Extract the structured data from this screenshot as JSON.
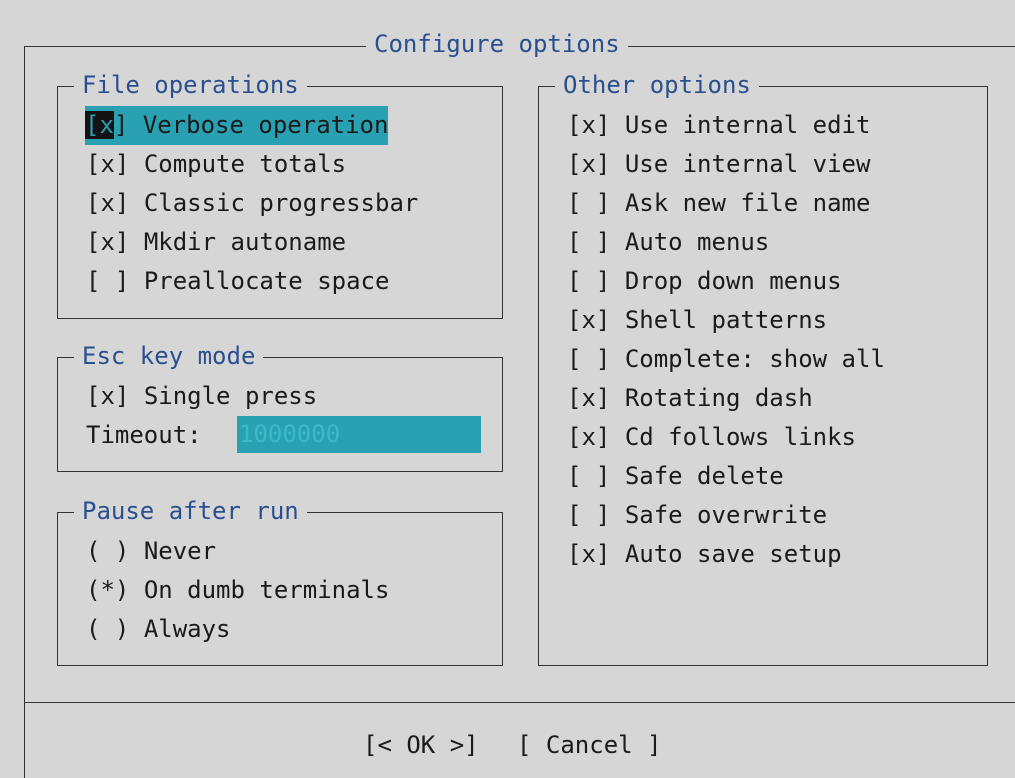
{
  "dialog": {
    "title": "Configure options"
  },
  "file_operations": {
    "title": "File operations",
    "items": [
      {
        "mark": "[x]",
        "label": "Verbose operation"
      },
      {
        "mark": "[x]",
        "label": "Compute totals"
      },
      {
        "mark": "[x]",
        "label": "Classic progressbar"
      },
      {
        "mark": "[x]",
        "label": "Mkdir autoname"
      },
      {
        "mark": "[ ]",
        "label": "Preallocate space"
      }
    ]
  },
  "esc_key_mode": {
    "title": "Esc key mode",
    "single_press": {
      "mark": "[x]",
      "label": "Single press"
    },
    "timeout_label": "Timeout:",
    "timeout_value": "1000000"
  },
  "pause_after_run": {
    "title": "Pause after run",
    "items": [
      {
        "mark": "( )",
        "label": "Never"
      },
      {
        "mark": "(*)",
        "label": "On dumb terminals"
      },
      {
        "mark": "( )",
        "label": "Always"
      }
    ]
  },
  "other_options": {
    "title": "Other options",
    "items": [
      {
        "mark": "[x]",
        "label": "Use internal edit"
      },
      {
        "mark": "[x]",
        "label": "Use internal view"
      },
      {
        "mark": "[ ]",
        "label": "Ask new file name"
      },
      {
        "mark": "[ ]",
        "label": "Auto menus"
      },
      {
        "mark": "[ ]",
        "label": "Drop down menus"
      },
      {
        "mark": "[x]",
        "label": "Shell patterns"
      },
      {
        "mark": "[ ]",
        "label": "Complete: show all"
      },
      {
        "mark": "[x]",
        "label": "Rotating dash"
      },
      {
        "mark": "[x]",
        "label": "Cd follows links"
      },
      {
        "mark": "[ ]",
        "label": "Safe delete"
      },
      {
        "mark": "[ ]",
        "label": "Safe overwrite"
      },
      {
        "mark": "[x]",
        "label": "Auto save setup"
      }
    ]
  },
  "buttons": {
    "ok": "[< OK >]",
    "cancel": "[ Cancel ]"
  },
  "colors": {
    "background": "#d6d6d6",
    "focus": "#2aa1b3",
    "hotkey": "#2a4f8f"
  }
}
